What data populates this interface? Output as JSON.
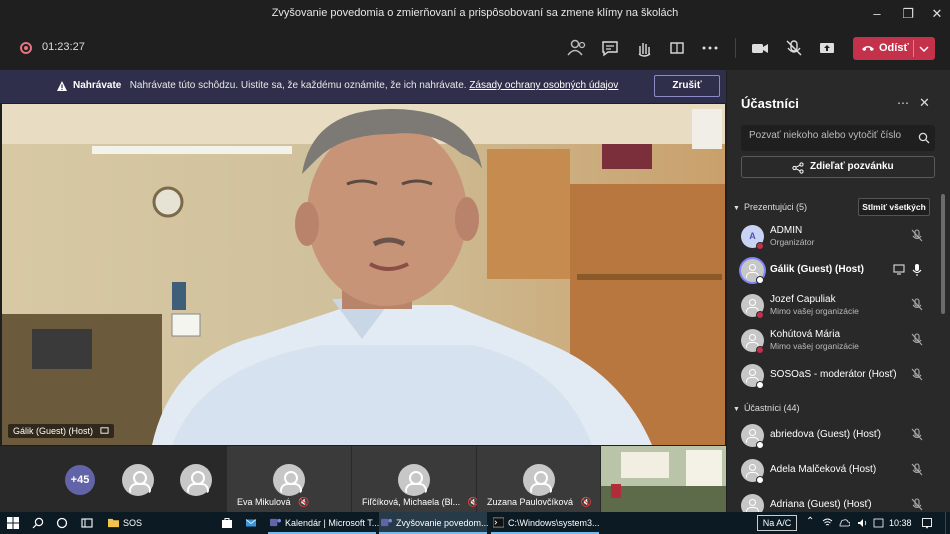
{
  "window": {
    "title": "Zvyšovanie povedomia o zmierňovaní a prispôsobovaní sa zmene klímy na školách"
  },
  "toolbar": {
    "timer": "01:23:27",
    "leave_label": "Odísť"
  },
  "banner": {
    "bold_label": "Nahrávate",
    "message": "Nahrávate túto schôdzu. Uistite sa, že každému oznámite, že ich nahrávate.",
    "link": "Zásady ochrany osobných údajov",
    "dismiss_label": "Zrušiť"
  },
  "main_video": {
    "name_label": "Gálik (Guest) (Host)"
  },
  "strip": {
    "overflow_count": "+45",
    "tiles": [
      {
        "name": "Eva Mikulová"
      },
      {
        "name": "Fiľčíková, Michaela (Bl..."
      },
      {
        "name": "Zuzana Paulovčíková"
      }
    ]
  },
  "panel": {
    "title": "Účastníci",
    "search_placeholder": "Pozvať niekoho alebo vytočiť číslo",
    "share_label": "Zdieľať pozvánku",
    "presenters_header": "Prezentujúci (5)",
    "mute_all_label": "Stlmiť všetkých",
    "presenters": [
      {
        "initial": "A",
        "name": "ADMIN",
        "sub": "Organizátor",
        "bold": false,
        "status_color": "#c4314b"
      },
      {
        "initial": "",
        "name": "Gálik (Guest) (Host)",
        "sub": "",
        "bold": true,
        "status_color": "#ffffff"
      },
      {
        "initial": "",
        "name": "Jozef Capuliak",
        "sub": "Mimo vašej organizácie",
        "bold": false,
        "status_color": "#c4314b"
      },
      {
        "initial": "",
        "name": "Kohútová Mária",
        "sub": "Mimo vašej organizácie",
        "bold": false,
        "status_color": "#c4314b"
      },
      {
        "initial": "",
        "name": "SOSOaS - moderátor (Hosť)",
        "sub": "",
        "bold": false,
        "status_color": "#ffffff"
      }
    ],
    "attendees_header": "Účastníci (44)",
    "attendees": [
      {
        "name": "abriedova (Guest) (Hosť)"
      },
      {
        "name": "Adela Malčeková (Host)"
      },
      {
        "name": "Adriana (Guest) (Hosť)"
      }
    ]
  },
  "taskbar": {
    "items": [
      {
        "label": "SOS",
        "icon": "folder-icon"
      },
      {
        "label": "Kalendár | Microsoft T...",
        "icon": "teams-icon"
      },
      {
        "label": "Zvyšovanie povedom...",
        "icon": "teams-icon"
      },
      {
        "label": "C:\\Windows\\system3...",
        "icon": "cmd-icon"
      }
    ],
    "na_label": "Na A/C",
    "clock": "10:38"
  },
  "colors": {
    "accent": "#6264a7",
    "leave_red": "#c4314b",
    "banner_bg": "#2f2f4b"
  }
}
